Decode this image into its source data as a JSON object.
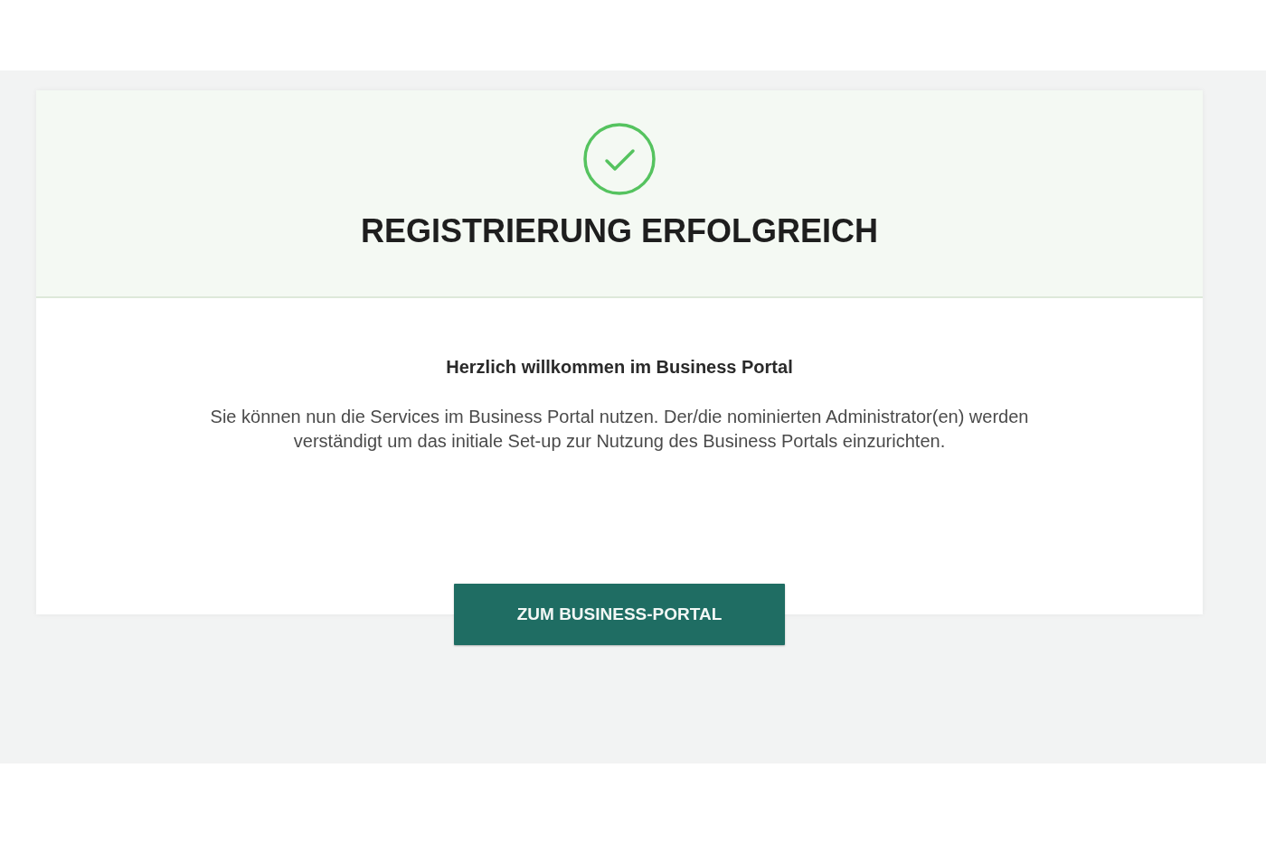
{
  "header": {
    "title": "REGISTRIERUNG ERFOLGREICH"
  },
  "welcome": "Herzlich willkommen im Business Portal",
  "message": "Sie können nun die Services im Business Portal nutzen. Der/die nominierten Administrator(en) werden verständigt um das initiale Set-up zur Nutzung des Business Portals einzurichten.",
  "button": {
    "label": "ZUM BUSINESS-PORTAL"
  }
}
